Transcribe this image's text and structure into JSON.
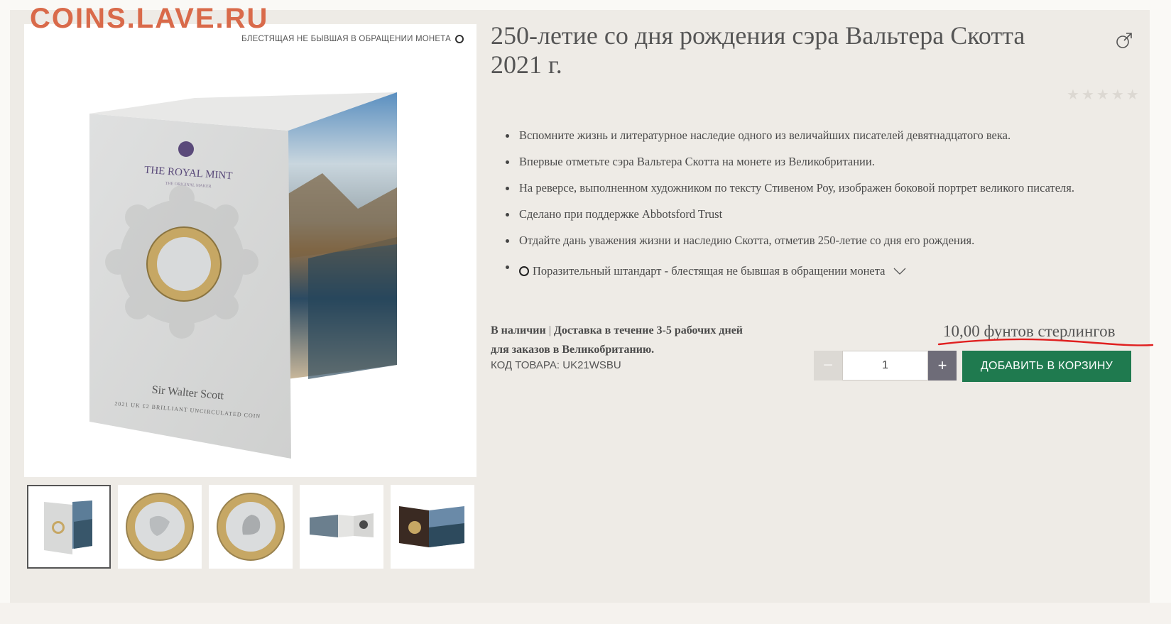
{
  "watermark": "COINS.LAVE.RU",
  "image": {
    "finish_label": "БЛЕСТЯЩАЯ НЕ БЫВШАЯ В ОБРАЩЕНИИ МОНЕТА",
    "packaging": {
      "brand": "THE ROYAL MINT",
      "brand_sub": "THE ORIGINAL MAKER",
      "name": "Sir Walter Scott",
      "desc": "2021 UK £2 BRILLIANT UNCIRCULATED COIN"
    }
  },
  "thumbnails": [
    {
      "icon": "packaging-front-thumb"
    },
    {
      "icon": "coin-reverse-thumb"
    },
    {
      "icon": "coin-obverse-thumb"
    },
    {
      "icon": "packaging-open-thumb"
    },
    {
      "icon": "packaging-landscape-thumb"
    }
  ],
  "product": {
    "title": "250-летие со дня рождения сэра Вальтера Скотта 2021 г.",
    "rating_stars": 5,
    "features": [
      "Вспомните жизнь и литературное наследие одного из величайших писателей девятнадцатого века.",
      "Впервые отметьте сэра Вальтера Скотта на монете из Великобритании.",
      "На реверсе, выполненном художником по тексту Стивеном Роу, изображен боковой портрет великого писателя.",
      "Сделано при поддержке Abbotsford Trust",
      "Отдайте дань уважения жизни и наследию Скотта, отметив 250-летие со дня его рождения."
    ],
    "finish_option": "Поразительный штандарт - блестящая не бывшая в обращении монета",
    "stock": "В наличии",
    "stock_separator": "|",
    "delivery": "Доставка в течение 3-5 рабочих дней для заказов в Великобританию.",
    "sku": "КОД ТОВАРА: UK21WSBU",
    "price": "10,00 фунтов стерлингов",
    "quantity": "1",
    "qty_minus": "−",
    "qty_plus": "+",
    "add_to_cart": "ДОБАВИТЬ В КОРЗИНУ"
  },
  "colors": {
    "page": "#eeebe6",
    "accent_green": "#1f7a4f",
    "watermark": "#d96a4a",
    "annotation_red": "#e02020"
  }
}
